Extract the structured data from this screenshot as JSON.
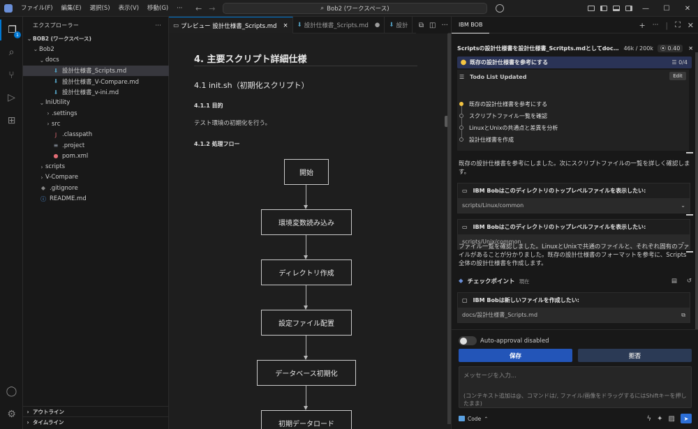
{
  "titlebar": {
    "menus": [
      "ファイル(F)",
      "編集(E)",
      "選択(S)",
      "表示(V)",
      "移動(G)",
      "···"
    ],
    "search": "Bob2 (ワークスペース)"
  },
  "activity": {
    "explorer_badge": "1"
  },
  "sidebar": {
    "header": "エクスプローラー",
    "more": "···",
    "items": [
      {
        "label": "BOB2 (ワークスペース)",
        "chev": "⌄",
        "icon": "",
        "indent": 0
      },
      {
        "label": "Bob2",
        "chev": "⌄",
        "icon": "",
        "indent": 1
      },
      {
        "label": "docs",
        "chev": "⌄",
        "icon": "",
        "indent": 2
      },
      {
        "label": "設計仕様書_Scripts.md",
        "chev": "",
        "icon": "⬇",
        "indent": 3,
        "selected": true
      },
      {
        "label": "設計仕様書_V-Compare.md",
        "chev": "",
        "icon": "⬇",
        "indent": 3
      },
      {
        "label": "設計仕様書_v-ini.md",
        "chev": "",
        "icon": "⬇",
        "indent": 3
      },
      {
        "label": "IniUtility",
        "chev": "⌄",
        "icon": "",
        "indent": 2
      },
      {
        "label": ".settings",
        "chev": "›",
        "icon": "",
        "indent": 3
      },
      {
        "label": "src",
        "chev": "›",
        "icon": "",
        "indent": 3
      },
      {
        "label": ".classpath",
        "chev": "",
        "icon": "J",
        "indent": 3
      },
      {
        "label": ".project",
        "chev": "",
        "icon": "≡",
        "indent": 3
      },
      {
        "label": "pom.xml",
        "chev": "",
        "icon": "●",
        "indent": 3
      },
      {
        "label": "scripts",
        "chev": "›",
        "icon": "",
        "indent": 2
      },
      {
        "label": "V-Compare",
        "chev": "›",
        "icon": "",
        "indent": 2
      },
      {
        "label": ".gitignore",
        "chev": "",
        "icon": "◆",
        "indent": 1
      },
      {
        "label": "README.md",
        "chev": "",
        "icon": "ⓘ",
        "indent": 1
      }
    ],
    "outline": "アウトライン",
    "timeline": "タイムライン"
  },
  "editor": {
    "tabs": [
      {
        "label": "プレビュー 設計仕様書_Scripts.md",
        "close": "×",
        "active": true
      },
      {
        "label": "設計仕様書_Scripts.md",
        "close": "●",
        "active": false
      },
      {
        "label": "設計",
        "close": "",
        "active": false
      }
    ],
    "preview": {
      "h2": "4. 主要スクリプト詳細仕様",
      "h3": "4.1 init.sh（初期化スクリプト）",
      "h4_purpose": "4.1.1 目的",
      "purpose_text": "テスト環境の初期化を行う。",
      "h4_flow": "4.1.2 処理フロー",
      "flow": [
        "開始",
        "環境変数読み込み",
        "ディレクトリ作成",
        "設定ファイル配置",
        "データベース初期化",
        "初期データロード"
      ]
    }
  },
  "panel": {
    "tab": "IBM BOB",
    "task_title": "Scriptsの設計仕様書を設計仕様書_Scritpts.mdとしてdocs...",
    "tokens": "46k / 200k",
    "cost": "0.40",
    "current_todo": "既存の設計仕様書を参考にする",
    "todo_progress": "0/4",
    "todo_title": "Todo List Updated",
    "edit": "Edit",
    "todos": [
      "既存の設計仕様書を参考にする",
      "スクリプトファイル一覧を確認",
      "LinuxとUnixの共通点と差異を分析",
      "設計仕様書を作成"
    ],
    "msg1": "既存の設計仕様書を参考にしました。次にスクリプトファイルの一覧を詳しく確認します。",
    "tool1_head": "IBM Bobはこのディレクトリのトップレベルファイルを表示したい:",
    "tool1_path": "scripts/Linux/common",
    "tool2_head": "IBM Bobはこのディレクトリのトップレベルファイルを表示したい:",
    "tool2_path": "scripts/Unix/common",
    "msg2": "ファイル一覧を確認しました。LinuxとUnixで共通のファイルと、それぞれ固有のファイルがあることが分かりました。既存の設計仕様書のフォーマットを参考に、Scripts全体の設計仕様書を作成します。",
    "checkpoint": "チェックポイント",
    "checkpoint_now": "現在",
    "tool3_head": "IBM Bobは新しいファイルを作成したい:",
    "tool3_path": "docs/設計仕様書_Scripts.md",
    "auto_approval": "Auto-approval disabled",
    "save": "保存",
    "reject": "拒否",
    "input_placeholder": "メッセージを入力...",
    "input_hint": "(コンテキスト追加は@、コマンドは/, ファイル/画像をドラッグするにはShiftキーを押したまま)",
    "mode": "Code"
  }
}
